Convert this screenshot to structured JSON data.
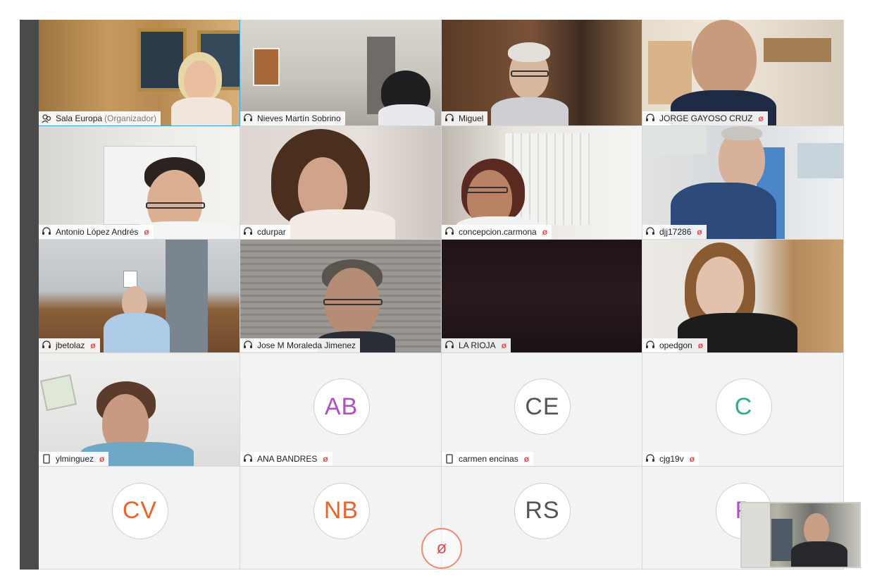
{
  "colors": {
    "active_border": "#3aa4e0",
    "mic_muted": "#e05050",
    "avatar_purple": "#b14fc5",
    "avatar_gray": "#555555",
    "avatar_teal": "#2fae8c",
    "avatar_orange": "#e8652b"
  },
  "tiles": [
    {
      "name": "Sala Europa",
      "role": "(Organizador)",
      "device": "conference-room-icon",
      "muted": false
    },
    {
      "name": "Nieves Martín Sobrino",
      "device": "headset-icon",
      "muted": false
    },
    {
      "name": "Miguel",
      "device": "headset-icon",
      "muted": false
    },
    {
      "name": "JORGE GAYOSO CRUZ",
      "device": "headset-icon",
      "muted": true
    },
    {
      "name": "Antonio López Andrés",
      "device": "headset-icon",
      "muted": true
    },
    {
      "name": "cdurpar",
      "device": "headset-icon",
      "muted": false
    },
    {
      "name": "concepcion.carmona",
      "device": "headset-icon",
      "muted": true
    },
    {
      "name": "djj17286",
      "device": "headset-icon",
      "muted": true
    },
    {
      "name": "jbetolaz",
      "device": "headset-icon",
      "muted": true
    },
    {
      "name": "Jose M Moraleda Jimenez",
      "device": "headset-icon",
      "muted": false
    },
    {
      "name": "LA RIOJA",
      "device": "headset-icon",
      "muted": true
    },
    {
      "name": "opedgon",
      "device": "headset-icon",
      "muted": true
    },
    {
      "name": "ylminguez",
      "device": "phone-icon",
      "muted": true
    },
    {
      "name": "ANA BANDRES",
      "initials": "AB",
      "device": "headset-icon",
      "muted": true
    },
    {
      "name": "carmen encinas",
      "initials": "CE",
      "device": "phone-icon",
      "muted": true
    },
    {
      "name": "cjg19v",
      "initials": "C",
      "device": "headset-icon",
      "muted": true
    },
    {
      "initials": "CV"
    },
    {
      "initials": "NB"
    },
    {
      "initials": "RS"
    },
    {
      "initials": "P"
    }
  ],
  "mute_glyph": "ø",
  "mic_off_glyph": "ø"
}
